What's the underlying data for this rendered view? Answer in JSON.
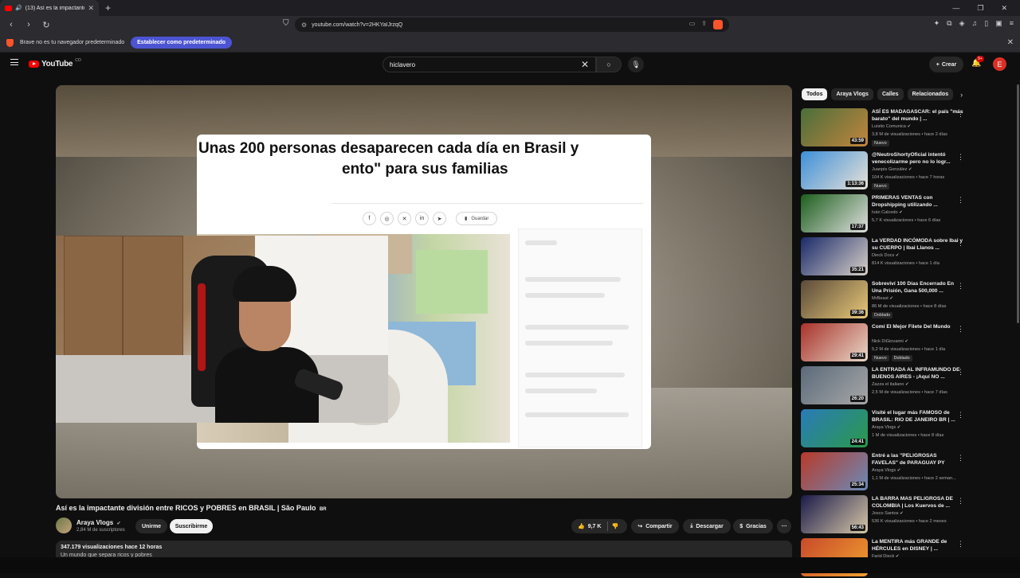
{
  "browser": {
    "tab_title": "(13) Así es la impactante divis",
    "url": "youtube.com/watch?v=2HKYaIJrzqQ",
    "infobar_text": "Brave no es tu navegador predeterminado",
    "infobar_button": "Establecer como predeterminado"
  },
  "header": {
    "logo_text": "YouTube",
    "logo_country": "CO",
    "search_value": "hiclavero",
    "create_label": "Crear",
    "notif_count": "9+",
    "avatar_letter": "E"
  },
  "player": {
    "headline_line1": "Unas 200 personas desaparecen cada día en Brasil y",
    "headline_line2": "ento\" para sus familias",
    "save_label": "Guardar"
  },
  "video": {
    "title": "Así es la impactante división entre RICOS y POBRES en BRASIL | São Paulo",
    "title_flag": "BR",
    "channel": "Araya Vlogs",
    "subscribers": "2,84 M de suscriptores",
    "join_label": "Unirme",
    "subscribe_label": "Suscribirme",
    "likes": "9,7 K",
    "share_label": "Compartir",
    "download_label": "Descargar",
    "thanks_label": "Gracias",
    "views_line": "347.179 visualizaciones  hace 12 horas",
    "desc_line": "Un mundo que separa ricos y pobres"
  },
  "chips": [
    "Todos",
    "Araya Vlogs",
    "Calles",
    "Relacionados"
  ],
  "recommendations": [
    {
      "title": "ASÍ ES MADAGASCAR: el país \"más barato\" del mundo | ...",
      "channel": "Luisito Comunica",
      "meta": "3,8 M de visualizaciones • hace 2 días",
      "duration": "43:59",
      "badges": [
        "Nuevo"
      ],
      "colors": [
        "#4a6e3a",
        "#c2853e"
      ]
    },
    {
      "title": "@NeutroShortyOficial intentó venecolizarme pero no lo logr...",
      "channel": "Juanpis González",
      "meta": "104 K visualizaciones • hace 7 horas",
      "duration": "1:13:36",
      "badges": [
        "Nuevo"
      ],
      "colors": [
        "#3d8fd8",
        "#e8e2d8"
      ]
    },
    {
      "title": "PRIMERAS VENTAS con Dropshipping utilizando ...",
      "channel": "Iván Calcedo",
      "meta": "5,7 K visualizaciones • hace 6 días",
      "duration": "17:37",
      "badges": [],
      "colors": [
        "#1c5e1c",
        "#e0e0e0"
      ]
    },
    {
      "title": "La VERDAD INCÓMODA sobre Ibai y su CUERPO | Ibai Llanos ...",
      "channel": "Dieck Docs",
      "meta": "814 K visualizaciones • hace 1 día",
      "duration": "35:21",
      "badges": [],
      "colors": [
        "#1a2a6a",
        "#d8d0c8"
      ]
    },
    {
      "title": "Sobreviví 100 Días Encerrado En Una Prisión, Gana 500,000 ...",
      "channel": "MrBeast",
      "meta": "86 M de visualizaciones • hace 8 días",
      "duration": "39:36",
      "badges": [
        "Doblado"
      ],
      "colors": [
        "#5a4a3a",
        "#e8c878"
      ]
    },
    {
      "title": "Comí El Mejor Filete Del Mundo",
      "channel": "Nick DiGiovanni",
      "meta": "5,2 M de visualizaciones • hace 1 día",
      "duration": "29:41",
      "badges": [
        "Nuevo",
        "Doblado"
      ],
      "colors": [
        "#a8322a",
        "#e8d8c8"
      ]
    },
    {
      "title": "LA ENTRADA AL INFRAMUNDO DE BUENOS AIRES - ¡Aquí NO ...",
      "channel": "Zazza el italiano",
      "meta": "2,5 M de visualizaciones • hace 7 días",
      "duration": "26:20",
      "badges": [],
      "colors": [
        "#5a6a7a",
        "#a8a8a8"
      ]
    },
    {
      "title": "Visité el lugar más FAMOSO de BRASIL: RIO DE JANEIRO BR | ...",
      "channel": "Araya Vlogs",
      "meta": "1 M de visualizaciones • hace 8 días",
      "duration": "24:41",
      "badges": [],
      "colors": [
        "#2a7ab8",
        "#2a9a4a"
      ]
    },
    {
      "title": "Entré a las \"PELIGROSAS FAVELAS\" de PARAGUAY PY",
      "channel": "Araya Vlogs",
      "meta": "1,1 M de visualizaciones • hace 2 seman...",
      "duration": "25:34",
      "badges": [],
      "colors": [
        "#b83a2a",
        "#6a8ab8"
      ]
    },
    {
      "title": "LA BARRA MAS PELIGROSA DE COLOMBIA | Los Kuervos de ...",
      "channel": "Josco Santos",
      "meta": "536 K visualizaciones • hace 2 meses",
      "duration": "56:43",
      "badges": [],
      "colors": [
        "#1a1a4a",
        "#d8c8a8"
      ]
    },
    {
      "title": "La MENTIRA más GRANDE de HÉRCULES en DISNEY | ...",
      "channel": "Farid Dieck",
      "meta": "",
      "duration": "",
      "badges": [],
      "colors": [
        "#c84a2a",
        "#f0a030"
      ]
    }
  ]
}
